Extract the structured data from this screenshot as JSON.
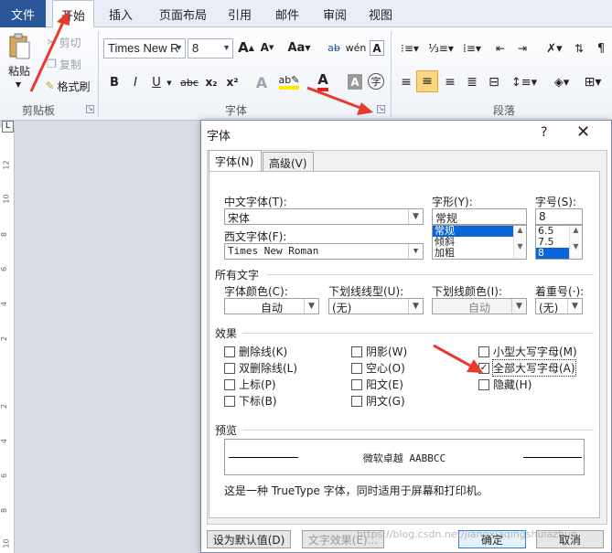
{
  "ribbon_tabs": [
    "文件",
    "开始",
    "插入",
    "页面布局",
    "引用",
    "邮件",
    "审阅",
    "视图"
  ],
  "clipboard": {
    "paste": "粘贴",
    "cut": "剪切",
    "copy": "复制",
    "format_painter": "格式刷",
    "group_label": "剪贴板"
  },
  "font_group": {
    "font_name": "Times New R",
    "font_size": "8",
    "group_label": "字体",
    "buttons": [
      "B",
      "I",
      "U",
      "abc",
      "x₂",
      "x²",
      "A",
      "A",
      "A",
      "字"
    ],
    "case_button": "Aa"
  },
  "paragraph_group": {
    "group_label": "段落"
  },
  "ruler_numbers": [
    "12",
    "10",
    "8",
    "6",
    "4",
    "2",
    "2",
    "4",
    "6",
    "8",
    "10"
  ],
  "dialog": {
    "title": "字体",
    "help": "?",
    "close": "✕",
    "tabs": [
      "字体(N)",
      "高级(V)"
    ],
    "chinese_font_label": "中文字体(T):",
    "chinese_font_value": "宋体",
    "western_font_label": "西文字体(F):",
    "western_font_value": "Times New Roman",
    "style_label": "字形(Y):",
    "style_value": "常规",
    "style_options": [
      "常规",
      "倾斜",
      "加粗"
    ],
    "size_label": "字号(S):",
    "size_value": "8",
    "size_options": [
      "6.5",
      "7.5",
      "8"
    ],
    "all_text_header": "所有文字",
    "font_color_label": "字体颜色(C):",
    "font_color_value": "自动",
    "underline_label": "下划线线型(U):",
    "underline_value": "(无)",
    "underline_color_label": "下划线颜色(I):",
    "underline_color_value": "自动",
    "emphasis_label": "着重号(·):",
    "emphasis_value": "(无)",
    "effects_header": "效果",
    "effects": [
      {
        "label": "删除线(K)",
        "checked": false
      },
      {
        "label": "双删除线(L)",
        "checked": false
      },
      {
        "label": "上标(P)",
        "checked": false
      },
      {
        "label": "下标(B)",
        "checked": false
      },
      {
        "label": "阴影(W)",
        "checked": false
      },
      {
        "label": "空心(O)",
        "checked": false
      },
      {
        "label": "阳文(E)",
        "checked": false
      },
      {
        "label": "阴文(G)",
        "checked": false
      },
      {
        "label": "小型大写字母(M)",
        "checked": false
      },
      {
        "label": "全部大写字母(A)",
        "checked": true
      },
      {
        "label": "隐藏(H)",
        "checked": false
      }
    ],
    "preview_header": "预览",
    "preview_text": "微软卓越 AABBCC",
    "note": "这是一种 TrueType 字体，同时适用于屏幕和打印机。",
    "btn_default": "设为默认值(D)",
    "btn_effects": "文字效果(E)...",
    "btn_ok": "确定",
    "btn_cancel": "取消"
  },
  "watermark": "https://blog.csdn.net/jiangxiaqingshulazhuo",
  "colors": {
    "accent": "#2a5699",
    "arrow": "#e8392b",
    "selection": "#0a66d8"
  }
}
